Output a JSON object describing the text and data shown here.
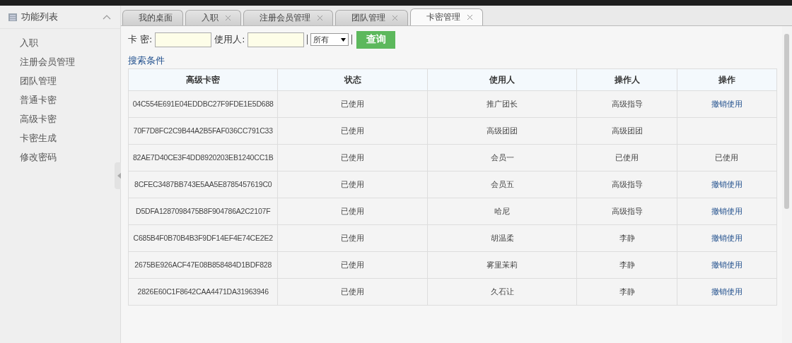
{
  "sidebar": {
    "title": "功能列表",
    "expanded": true,
    "items": [
      {
        "label": "入职"
      },
      {
        "label": "注册会员管理"
      },
      {
        "label": "团队管理"
      },
      {
        "label": "普通卡密"
      },
      {
        "label": "高级卡密"
      },
      {
        "label": "卡密生成"
      },
      {
        "label": "修改密码"
      }
    ]
  },
  "tabs": [
    {
      "label": "我的桌面",
      "closable": false,
      "selected": false
    },
    {
      "label": "入职",
      "closable": true,
      "selected": false
    },
    {
      "label": "注册会员管理",
      "closable": true,
      "selected": false
    },
    {
      "label": "团队管理",
      "closable": true,
      "selected": false
    },
    {
      "label": "卡密管理",
      "closable": true,
      "selected": true
    }
  ],
  "filter": {
    "card_label": "卡 密:",
    "user_label": "使用人:",
    "select_value": "所有",
    "button": "查询"
  },
  "search_link": "搜索条件",
  "table": {
    "columns": [
      "高级卡密",
      "状态",
      "使用人",
      "操作人",
      "操作"
    ],
    "rows": [
      {
        "card": "04C554E691E04EDDBC27F9FDE1E5D688",
        "status": "已使用",
        "user": "推广团长",
        "operator": "高级指导",
        "action": {
          "text": "撤销使用",
          "kind": "link"
        }
      },
      {
        "card": "70F7D8FC2C9B44A2B5FAF036CC791C33",
        "status": "已使用",
        "user": "高级团团",
        "operator": "高级团团"
      },
      {
        "card": "82AE7D40CE3F4DD8920203EB1240CC1B",
        "status": "已使用",
        "user": "会员一",
        "operator": "已使用",
        "action": {
          "text": "已使用",
          "kind": "text"
        }
      },
      {
        "card": "8CFEC3487BB743E5AA5E8785457619C0",
        "status": "已使用",
        "user": "会员五",
        "operator": "高级指导",
        "action": {
          "text": "撤销使用",
          "kind": "link"
        }
      },
      {
        "card": "D5DFA1287098475B8F904786A2C2107F",
        "status": "已使用",
        "user": "哈尼",
        "operator": "高级指导",
        "action": {
          "text": "撤销使用",
          "kind": "link"
        }
      },
      {
        "card": "C685B4F0B70B4B3F9DF14EF4E74CE2E2",
        "status": "已使用",
        "user": "胡温柔",
        "operator": "李静",
        "action": {
          "text": "撤销使用",
          "kind": "link"
        }
      },
      {
        "card": "2675BE926ACF47E08B858484D1BDF828",
        "status": "已使用",
        "user": "雾里茉莉",
        "operator": "李静",
        "action": {
          "text": "撤销使用",
          "kind": "link"
        }
      },
      {
        "card": "2826E60C1F8642CAA4471DA31963946",
        "status": "已使用",
        "user": "久石让",
        "operator": "李静",
        "action": {
          "text": "撤销使用",
          "kind": "link"
        }
      }
    ]
  }
}
